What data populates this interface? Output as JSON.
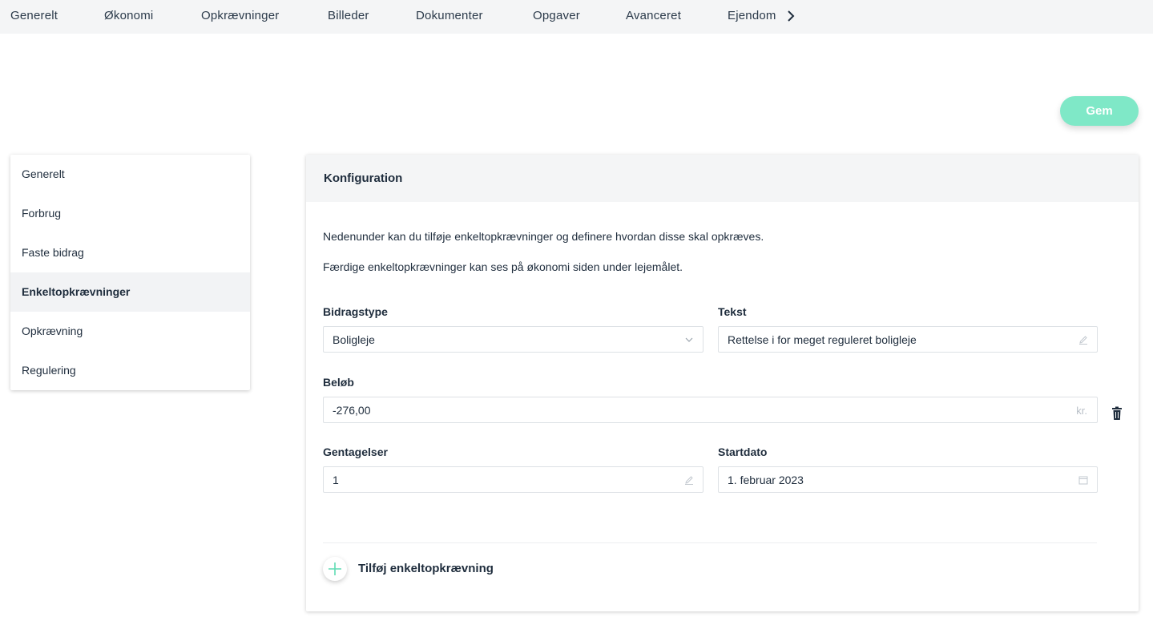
{
  "tabs": [
    {
      "label": "Generelt"
    },
    {
      "label": "Økonomi"
    },
    {
      "label": "Opkrævninger"
    },
    {
      "label": "Billeder"
    },
    {
      "label": "Dokumenter"
    },
    {
      "label": "Opgaver"
    },
    {
      "label": "Avanceret"
    },
    {
      "label": "Ejendom"
    }
  ],
  "save_label": "Gem",
  "side_menu": [
    {
      "label": "Generelt"
    },
    {
      "label": "Forbrug"
    },
    {
      "label": "Faste bidrag"
    },
    {
      "label": "Enkeltopkrævninger",
      "active": true
    },
    {
      "label": "Opkrævning"
    },
    {
      "label": "Regulering"
    }
  ],
  "card": {
    "title": "Konfiguration",
    "description_1": "Nedenunder kan du tilføje enkeltopkrævninger og definere hvordan disse skal opkræves.",
    "description_2": "Færdige enkeltopkrævninger kan ses på økonomi siden under lejemålet."
  },
  "form": {
    "bidragstype": {
      "label": "Bidragstype",
      "value": "Boligleje"
    },
    "tekst": {
      "label": "Tekst",
      "value": "Rettelse i for meget reguleret boligleje"
    },
    "belob": {
      "label": "Beløb",
      "value": "-276,00",
      "suffix": "kr."
    },
    "gentagelser": {
      "label": "Gentagelser",
      "value": "1"
    },
    "startdato": {
      "label": "Startdato",
      "value": "1. februar 2023"
    }
  },
  "add_label": "Tilføj enkeltopkrævning",
  "colors": {
    "accent": "#7fe8c7",
    "accent_dark": "#3ccfa0"
  },
  "icons": [
    "chevron-right-icon",
    "chevron-down-icon",
    "pencil-icon",
    "trash-icon",
    "calendar-icon",
    "plus-icon"
  ]
}
